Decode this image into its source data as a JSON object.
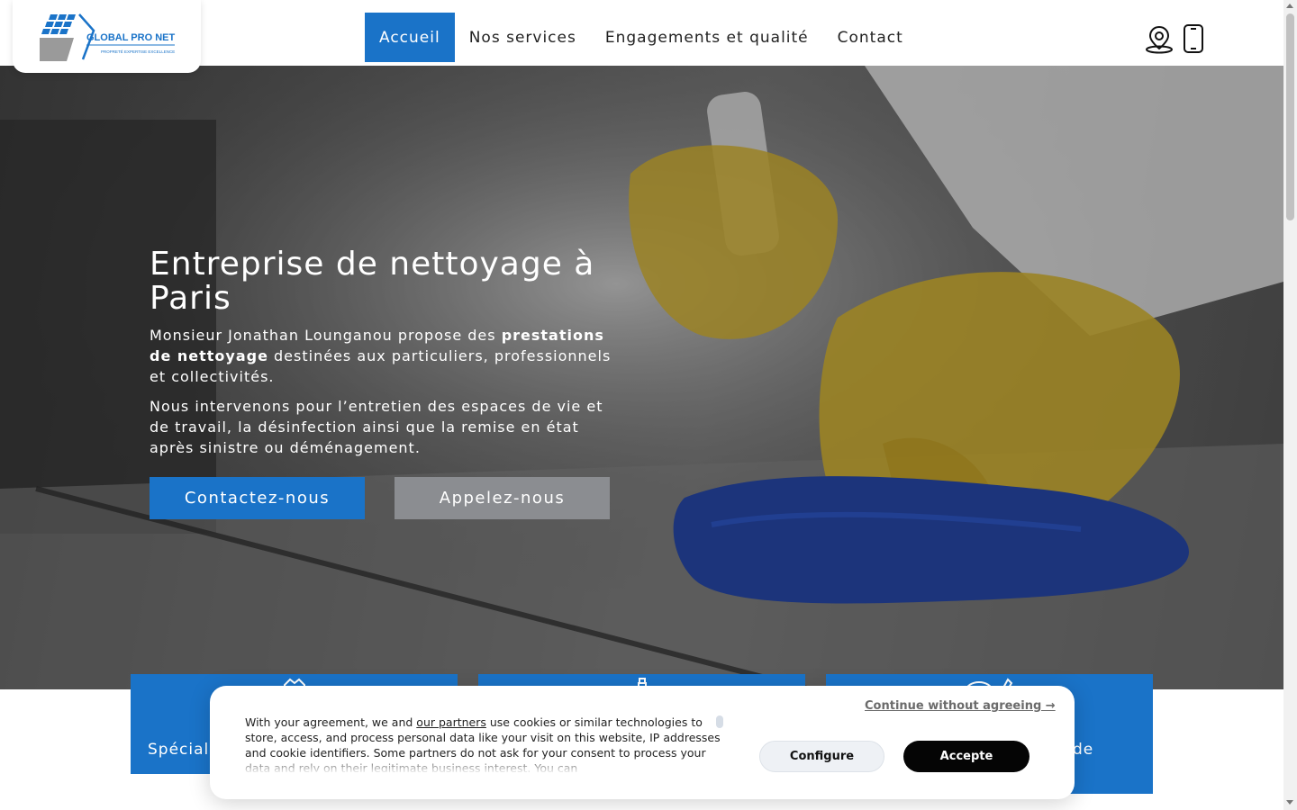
{
  "brand": {
    "logo_text": "GLOBAL PRO NET",
    "tagline": "PROPRETÉ EXPERTISE EXCELLENCE",
    "color": "#1a73c8"
  },
  "nav": {
    "items": [
      {
        "label": "Accueil",
        "active": true
      },
      {
        "label": "Nos services"
      },
      {
        "label": "Engagements et qualité"
      },
      {
        "label": "Contact"
      }
    ]
  },
  "header_icons": [
    "location-pin-icon",
    "smartphone-icon"
  ],
  "hero": {
    "title": "Entreprise de nettoyage à Paris",
    "p1_before": "Monsieur Jonathan Lounganou propose des ",
    "p1_bold": "prestations de nettoyage",
    "p1_after": " destinées aux particuliers, professionnels et collectivités.",
    "p2": "Nous intervenons pour l’entretien des espaces de vie et de travail, la désinfection ainsi que la remise en état après sinistre ou déménagement.",
    "btn_contact": "Contactez-nous",
    "btn_call": "Appelez-nous"
  },
  "cards": [
    {
      "text": "Spécial",
      "icon": "badge-icon"
    },
    {
      "text": "",
      "icon": "spray-bottle-icon"
    },
    {
      "text": "de",
      "icon": "cleaning-tools-icon"
    }
  ],
  "cookie": {
    "text_before": "With your agreement, we and ",
    "link": "our partners",
    "text_after": " use cookies or similar technologies to store, access, and process personal data like your visit on this website, IP addresses and cookie identifiers. Some partners do not ask for your consent to process your data and rely on their legitimate business interest. You can",
    "continue": "Continue without agreeing →",
    "configure": "Configure",
    "accept": "Accepte"
  }
}
